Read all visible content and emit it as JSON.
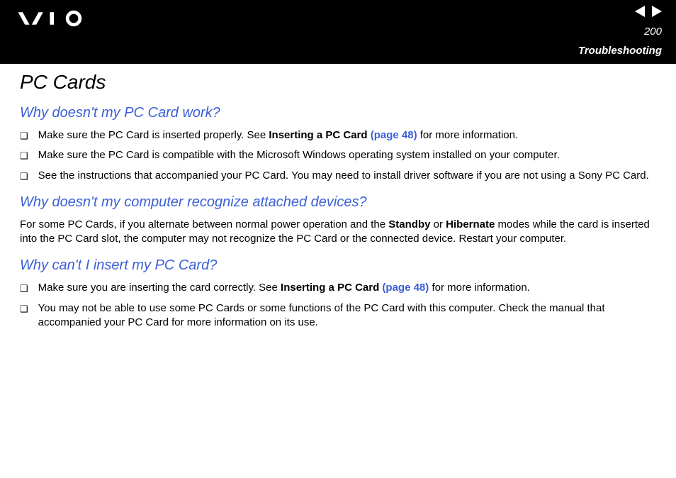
{
  "header": {
    "page_number": "200",
    "section": "Troubleshooting"
  },
  "title": "PC Cards",
  "q1": {
    "heading": "Why doesn't my PC Card work?",
    "b1_pre": "Make sure the PC Card is inserted properly. See ",
    "b1_bold": "Inserting a PC Card ",
    "b1_link": "(page 48)",
    "b1_post": " for more information.",
    "b2": "Make sure the PC Card is compatible with the Microsoft Windows operating system installed on your computer.",
    "b3": "See the instructions that accompanied your PC Card. You may need to install driver software if you are not using a Sony PC Card."
  },
  "q2": {
    "heading": "Why doesn't my computer recognize attached devices?",
    "p_pre": "For some PC Cards, if you alternate between normal power operation and the ",
    "p_b1": "Standby",
    "p_mid": " or ",
    "p_b2": "Hibernate",
    "p_post": " modes while the card is inserted into the PC Card slot, the computer may not recognize the PC Card or the connected device. Restart your computer."
  },
  "q3": {
    "heading": "Why can't I insert my PC Card?",
    "b1_pre": "Make sure you are inserting the card correctly. See ",
    "b1_bold": "Inserting a PC Card ",
    "b1_link": "(page 48)",
    "b1_post": " for more information.",
    "b2": "You may not be able to use some PC Cards or some functions of the PC Card with this computer. Check the manual that accompanied your PC Card for more information on its use."
  }
}
